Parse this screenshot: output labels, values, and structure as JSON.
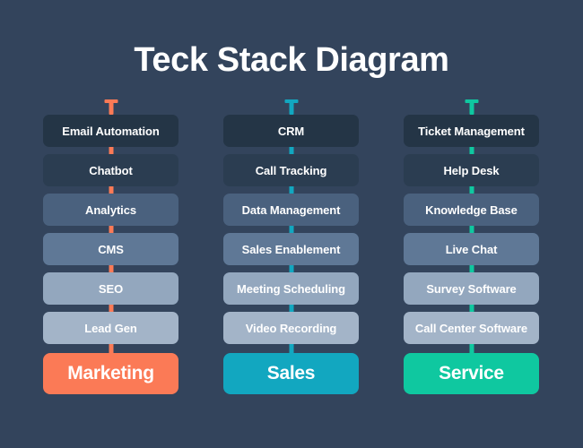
{
  "title": "Teck Stack Diagram",
  "theme": {
    "background": "#33445c",
    "tile_text": "#ffffff",
    "title_color": "#ffffff"
  },
  "tile_palette": [
    "#243546",
    "#2b3d51",
    "#4a617e",
    "#5f7896",
    "#93a7be",
    "#a3b4c8"
  ],
  "columns": [
    {
      "id": "marketing",
      "accent": "#fb7a56",
      "connector_icon": "t-connector-icon",
      "items": [
        "Email Automation",
        "Chatbot",
        "Analytics",
        "CMS",
        "SEO",
        "Lead Gen"
      ],
      "footer": "Marketing"
    },
    {
      "id": "sales",
      "accent": "#12a7c0",
      "connector_icon": "t-connector-icon",
      "items": [
        "CRM",
        "Call Tracking",
        "Data Management",
        "Sales Enablement",
        "Meeting Scheduling",
        "Video Recording"
      ],
      "footer": "Sales"
    },
    {
      "id": "service",
      "accent": "#0fc8a0",
      "connector_icon": "t-connector-icon",
      "items": [
        "Ticket Management",
        "Help Desk",
        "Knowledge Base",
        "Live Chat",
        "Survey Software",
        "Call Center Software"
      ],
      "footer": "Service"
    }
  ]
}
